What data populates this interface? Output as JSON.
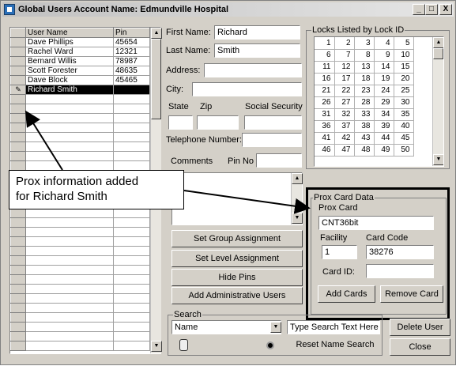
{
  "window": {
    "title": "Global Users Account Name: Edmundville Hospital",
    "min": "_",
    "max": "□",
    "close": "X"
  },
  "users_grid": {
    "columns": [
      "User Name",
      "Pin"
    ],
    "rows": [
      {
        "name": "Dave Phillips",
        "pin": "45654"
      },
      {
        "name": "Rachel Ward",
        "pin": "12321"
      },
      {
        "name": "Bernard Willis",
        "pin": "78987"
      },
      {
        "name": "Scott Forester",
        "pin": "48635"
      },
      {
        "name": "Dave Block",
        "pin": "45465"
      },
      {
        "name": "Richard Smith",
        "pin": ""
      }
    ]
  },
  "form": {
    "first_name_label": "First Name:",
    "first_name": "Richard",
    "last_name_label": "Last Name:",
    "last_name": "Smith",
    "address_label": "Address:",
    "address": "",
    "city_label": "City:",
    "city": "",
    "state_label": "State",
    "zip_label": "Zip",
    "ssn_label": "Social Security",
    "telephone_label": "Telephone Number:",
    "comments_label": "Comments",
    "pin_no_label": "Pin No"
  },
  "locks": {
    "title": "Locks Listed by Lock ID",
    "rows": [
      [
        1,
        2,
        3,
        4,
        5
      ],
      [
        6,
        7,
        8,
        9,
        10
      ],
      [
        11,
        12,
        13,
        14,
        15
      ],
      [
        16,
        17,
        18,
        19,
        20
      ],
      [
        21,
        22,
        23,
        24,
        25
      ],
      [
        26,
        27,
        28,
        29,
        30
      ],
      [
        31,
        32,
        33,
        34,
        35
      ],
      [
        36,
        37,
        38,
        39,
        40
      ],
      [
        41,
        42,
        43,
        44,
        45
      ],
      [
        46,
        47,
        48,
        49,
        50
      ]
    ]
  },
  "prox": {
    "title": "Prox Card Data",
    "prox_card_label": "Prox Card",
    "prox_card": "CNT36bit",
    "facility_label": "Facility",
    "facility": "1",
    "card_code_label": "Card Code",
    "card_code": "38276",
    "card_id_label": "Card ID:",
    "card_id": "",
    "add_cards": "Add Cards",
    "remove_card": "Remove Card"
  },
  "buttons": {
    "set_group": "Set Group Assignment",
    "set_level": "Set Level Assignment",
    "hide_pins": "Hide Pins",
    "add_admin": "Add Administrative Users",
    "delete_user": "Delete User",
    "close": "Close",
    "reset_name_search": "Reset Name Search"
  },
  "search": {
    "title": "Search",
    "field": "Name",
    "placeholder": "Type Search Text Here"
  },
  "callout": {
    "line1": "Prox information added",
    "line2": "for Richard Smith"
  }
}
